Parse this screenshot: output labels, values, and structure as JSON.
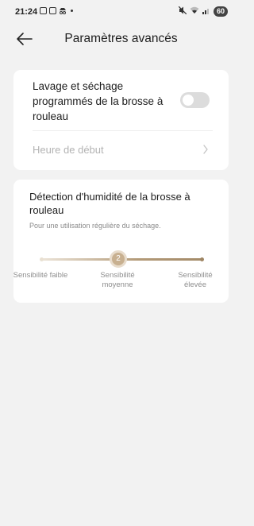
{
  "status_bar": {
    "time": "21:24",
    "battery": "60",
    "icons_left": [
      "screenshot-icon",
      "calendar-icon",
      "incognito-icon"
    ],
    "icons_right": [
      "mute-icon",
      "wifi-icon",
      "signal-icon",
      "battery-icon"
    ]
  },
  "header": {
    "title": "Paramètres avancés",
    "back_icon": "arrow-left-icon"
  },
  "scheduled_wash": {
    "label": "Lavage et séchage programmés de la brosse à rouleau",
    "enabled": false,
    "start_time_label": "Heure de début"
  },
  "humidity_detection": {
    "title": "Détection d'humidité de la brosse à rouleau",
    "subtitle": "Pour une utilisation régulière du séchage.",
    "slider_value": "2",
    "labels": [
      "Sensibilité faible",
      "Sensibilité moyenne",
      "Sensibilité élevée"
    ]
  },
  "colors": {
    "background": "#f2f2f2",
    "card": "#ffffff",
    "accent": "#b39a78",
    "toggle_off": "#dcdcdc"
  }
}
